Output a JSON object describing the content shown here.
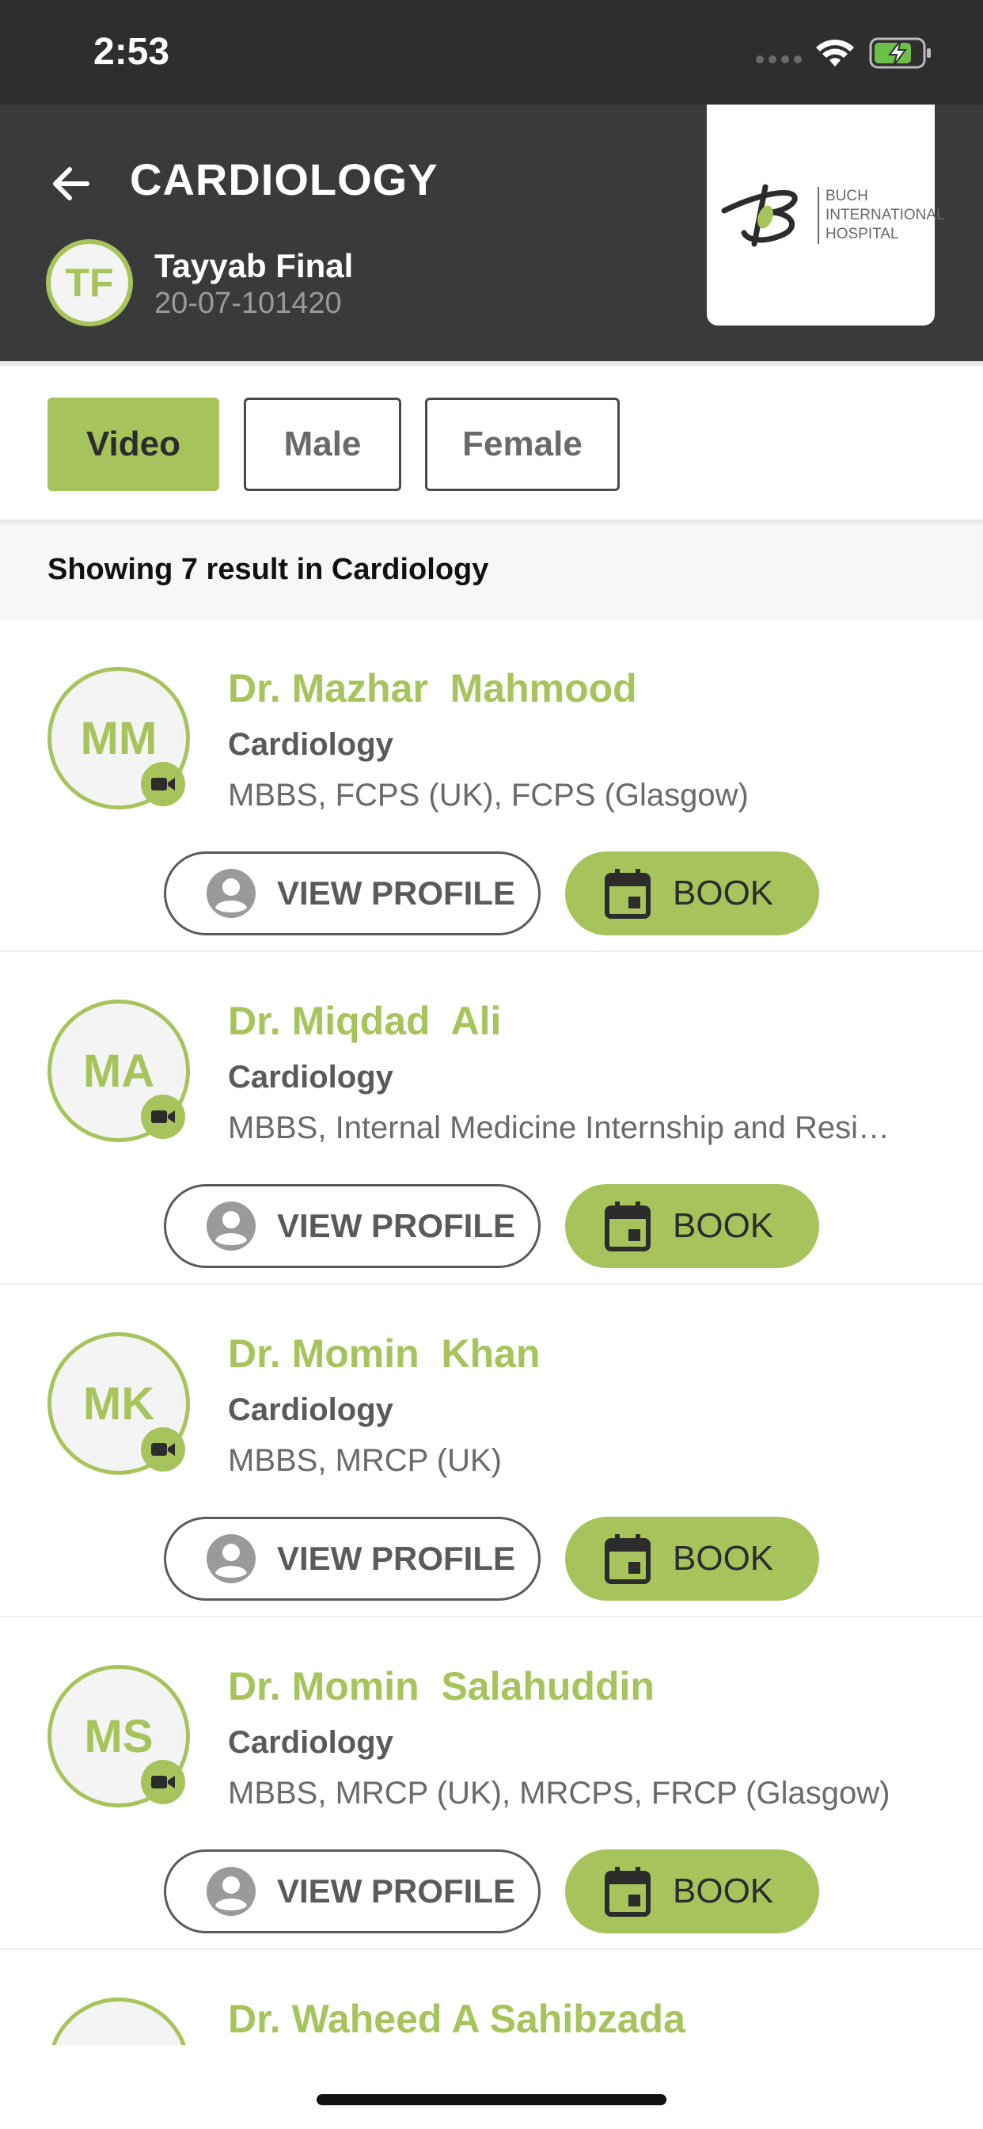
{
  "status_bar": {
    "time": "2:53"
  },
  "header": {
    "title": "CARDIOLOGY",
    "user": {
      "initials": "TF",
      "name": "Tayyab Final",
      "id": "20-07-101420"
    },
    "logo": {
      "line1": "BUCH",
      "line2": "INTERNATIONAL",
      "line3": "HOSPITAL"
    }
  },
  "filters": {
    "video": "Video",
    "male": "Male",
    "female": "Female",
    "active": "Video"
  },
  "results": {
    "text": "Showing 7 result in Cardiology"
  },
  "buttons": {
    "view_profile": "VIEW PROFILE",
    "book": "BOOK"
  },
  "doctors": [
    {
      "initials": "MM",
      "name": "Dr. Mazhar  Mahmood",
      "department": "Cardiology",
      "qualifications": "MBBS, FCPS (UK), FCPS (Glasgow)"
    },
    {
      "initials": "MA",
      "name": "Dr. Miqdad  Ali",
      "department": "Cardiology",
      "qualifications": "MBBS, Internal Medicine Internship and Resi…"
    },
    {
      "initials": "MK",
      "name": "Dr. Momin  Khan",
      "department": "Cardiology",
      "qualifications": "MBBS, MRCP (UK)"
    },
    {
      "initials": "MS",
      "name": "Dr. Momin  Salahuddin",
      "department": "Cardiology",
      "qualifications": "MBBS, MRCP (UK), MRCPS, FRCP (Glasgow)"
    },
    {
      "initials": "",
      "name": "Dr. Waheed A Sahibzada",
      "department": "",
      "qualifications": ""
    }
  ],
  "colors": {
    "accent": "#a6c45b",
    "header_bg": "#3a3a3a",
    "status_bg": "#2e2e2e"
  }
}
